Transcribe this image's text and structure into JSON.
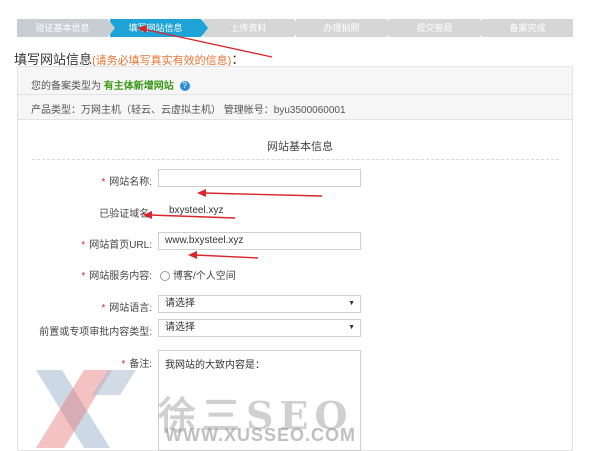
{
  "steps": [
    {
      "label": "验证基本信息",
      "state": "done"
    },
    {
      "label": "填写网站信息",
      "state": "active"
    },
    {
      "label": "上传资料",
      "state": "todo"
    },
    {
      "label": "办理拍照",
      "state": "todo"
    },
    {
      "label": "提交管局",
      "state": "todo"
    },
    {
      "label": "备案完成",
      "state": "todo"
    }
  ],
  "section": {
    "title": "填写网站信息",
    "note": "(请务必填写真实有效的信息)",
    "suffix": "："
  },
  "info": {
    "type_prefix": "您的备案类型为",
    "type_value": "有主体新增网站",
    "help_icon": "?",
    "product_line": "产品类型：万网主机（轻云、云虚拟主机）  管理帐号：byu3500060001"
  },
  "form": {
    "heading": "网站基本信息",
    "required_mark": "*",
    "site_name_label": "网站名称:",
    "site_name_value": "",
    "verified_domain_label": "已验证域名:",
    "verified_domain_value": "bxysteel.xyz",
    "homepage_label": "网站首页URL:",
    "homepage_value": "www.bxysteel.xyz",
    "service_label": "网站服务内容:",
    "service_option": "博客/个人空间",
    "language_label": "网站语言:",
    "language_value": "请选择",
    "approval_label": "前置或专项审批内容类型:",
    "approval_value": "请选择",
    "remark_label": "备注:",
    "remark_value": "我网站的大致内容是："
  },
  "colors": {
    "active_step": "#1ea3d6",
    "required": "#e02b2b",
    "note": "#e9712f",
    "annotation": "#d9262a"
  },
  "watermark": {
    "text": "徐三SEO",
    "url": "WWW.XUSSEO.COM"
  }
}
